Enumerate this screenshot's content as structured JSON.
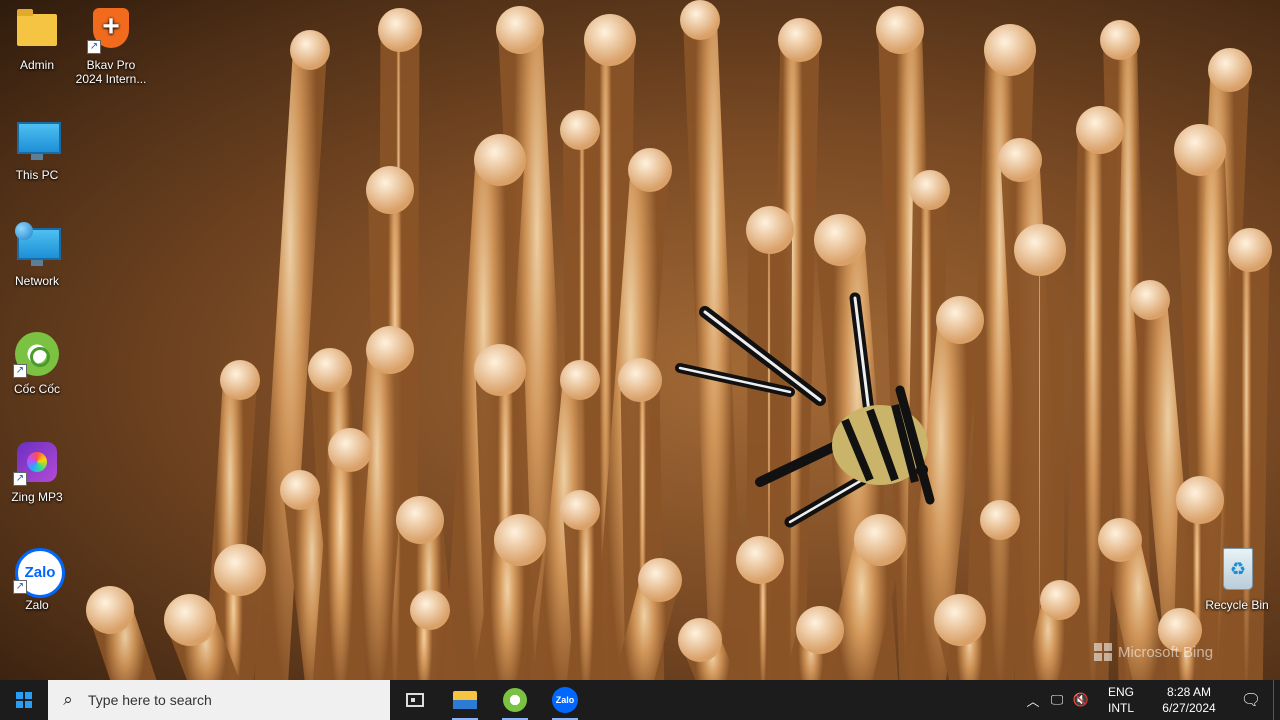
{
  "desktop": {
    "icons": [
      {
        "label": "Admin",
        "icon": "folder-icon"
      },
      {
        "label": "Bkav Pro 2024 Intern...",
        "icon": "bkav-shield-icon"
      },
      {
        "label": "This PC",
        "icon": "monitor-icon"
      },
      {
        "label": "Network",
        "icon": "network-icon"
      },
      {
        "label": "Cốc Cốc",
        "icon": "coccoc-icon"
      },
      {
        "label": "Zing MP3",
        "icon": "zing-mp3-icon"
      },
      {
        "label": "Zalo",
        "icon": "zalo-icon",
        "glyph_text": "Zalo"
      },
      {
        "label": "Recycle Bin",
        "icon": "recycle-bin-icon"
      }
    ],
    "watermark": "Microsoft Bing"
  },
  "taskbar": {
    "search_placeholder": "Type here to search",
    "pinned": [
      {
        "name": "Task View",
        "icon": "task-view-icon"
      },
      {
        "name": "File Explorer",
        "icon": "file-explorer-icon"
      },
      {
        "name": "Cốc Cốc",
        "icon": "coccoc-icon"
      },
      {
        "name": "Zalo",
        "icon": "zalo-icon",
        "glyph_text": "Zalo"
      }
    ],
    "tray": {
      "language_line1": "ENG",
      "language_line2": "INTL",
      "time": "8:28 AM",
      "date": "6/27/2024"
    }
  },
  "colors": {
    "taskbar_bg": "#1c1c1c",
    "windows_blue": "#2a9df4",
    "zalo_blue": "#0068ff"
  }
}
